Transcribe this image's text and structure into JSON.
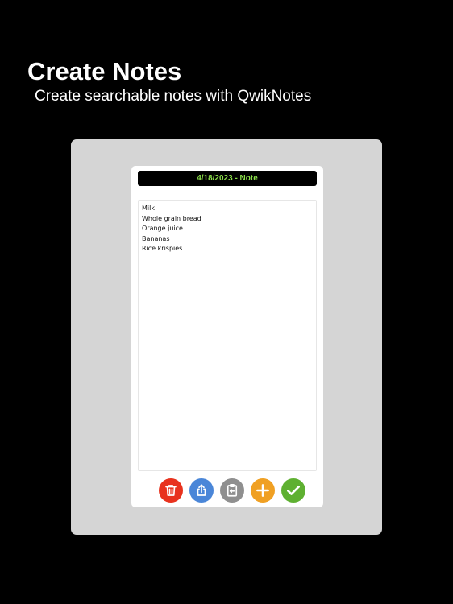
{
  "promo": {
    "headline": "Create Notes",
    "subheadline": "Create searchable notes with QwikNotes"
  },
  "note": {
    "title": "4/18/2023 - Note",
    "lines": [
      "Milk",
      "Whole grain bread",
      "Orange juice",
      "Bananas",
      "Rice krispies"
    ]
  },
  "toolbar": {
    "buttons": [
      {
        "name": "delete-button",
        "icon": "trash-icon",
        "color": "#e8321e"
      },
      {
        "name": "share-button",
        "icon": "share-icon",
        "color": "#4a86d8"
      },
      {
        "name": "paste-button",
        "icon": "clipboard-icon",
        "color": "#8f8f8f"
      },
      {
        "name": "add-button",
        "icon": "plus-icon",
        "color": "#f0a023"
      },
      {
        "name": "save-button",
        "icon": "checkmark-icon",
        "color": "#5eb031"
      }
    ]
  },
  "colors": {
    "background": "#000000",
    "frame": "#d5d5d5",
    "title_text": "#8ce04a"
  }
}
